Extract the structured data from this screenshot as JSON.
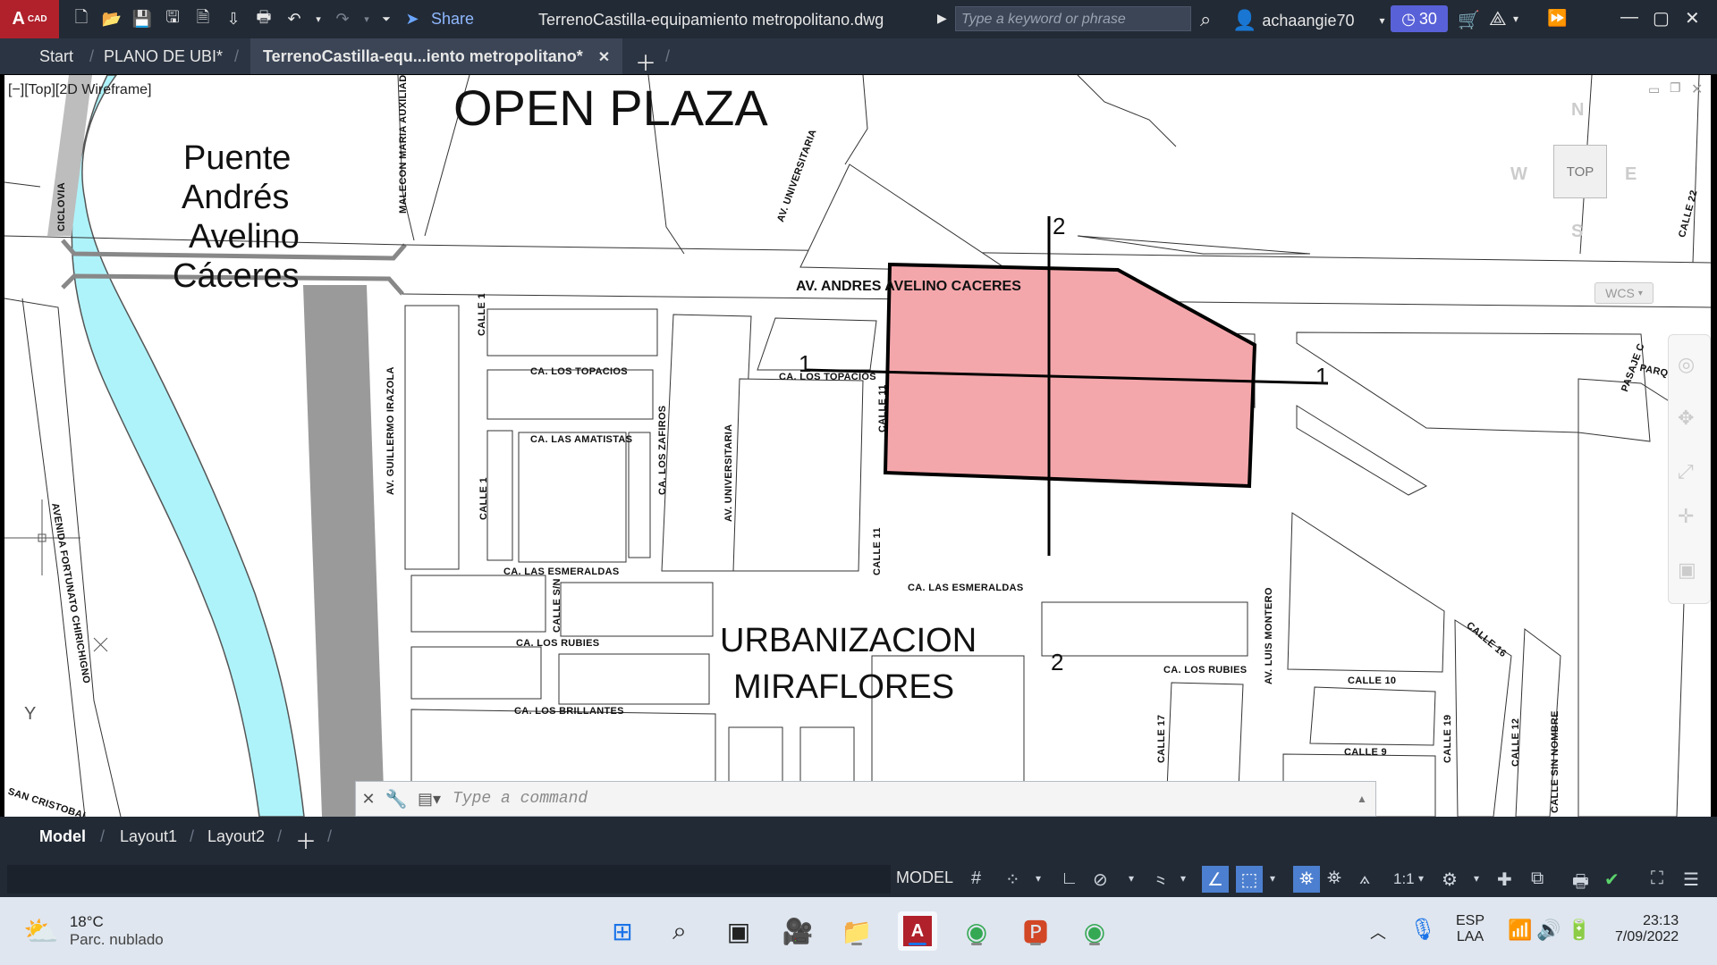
{
  "titlebar": {
    "app_badge": "A",
    "app_badge_sub": "CAD",
    "share_label": "Share",
    "document_title": "TerrenoCastilla-equipamiento metropolitano.dwg",
    "search_placeholder": "Type a keyword or phrase",
    "username": "achaangie70",
    "timer_value": "30"
  },
  "tabs": {
    "items": [
      {
        "label": "Start"
      },
      {
        "label": "PLANO DE UBI*"
      },
      {
        "label": "TerrenoCastilla-equ...iento metropolitano*"
      }
    ]
  },
  "viewport": {
    "label": "[−][Top][2D Wireframe]",
    "map": {
      "open_plaza": "OPEN PLAZA",
      "bridge_line1": "Puente",
      "bridge_line2": "Andrés",
      "bridge_line3": "Avelino",
      "bridge_line4": "Cáceres",
      "urbanizacion_line1": "URBANIZACION",
      "urbanizacion_line2": "MIRAFLORES",
      "av_andres": "AV.   ANDRES AVELINO CACERES",
      "section_2_top": "2",
      "section_2_bottom": "2",
      "section_1_left": "1",
      "section_1_right": "1",
      "streets": {
        "malecon": "MALECON MARIA AUXILIADORA",
        "ciclovia": "CICLOVIA",
        "av_universitaria_top": "AV. UNIVERSITARIA",
        "calle22": "CALLE 22",
        "los_topacios_1": "CA. LOS TOPACIOS",
        "los_topacios_2": "CA. LOS TOPACIOS",
        "las_amatistas": "CA. LAS AMATISTAS",
        "las_esmeraldas_1": "CA. LAS ESMERALDAS",
        "las_esmeraldas_2": "CA. LAS ESMERALDAS",
        "los_rubies_1": "CA. LOS RUBIES",
        "los_rubies_2": "CA. LOS RUBIES",
        "los_brillantes": "CA. LOS BRILLANTES",
        "calle1_a": "CALLE 1",
        "calle1_b": "CALLE 1",
        "calle11_a": "CALLE 11",
        "calle11_b": "CALLE 11",
        "calle_sn": "CALLE S/N",
        "los_zafiros": "CA. LOS ZAFIROS",
        "av_universitaria": "AV. UNIVERSITARIA",
        "av_guillermo": "AV. GUILLERMO IRAZOLA",
        "avenida_fortunato": "AVENIDA  FORTUNATO  CHIRICHIGNO",
        "av_luis_montero": "AV. LUIS MONTERO",
        "calle10": "CALLE 10",
        "calle9": "CALLE 9",
        "calle16": "CALLE 16",
        "calle17": "CALLE 17",
        "calle19": "CALLE 19",
        "calle12": "CALLE 12",
        "calle_sin_nombre": "CALLE SIN NOMBRE",
        "pasaje_c": "PASAJE C",
        "parque": "PARQUE",
        "san_cristobal": "SAN CRISTOBAL"
      }
    },
    "navcube": {
      "top": "TOP",
      "north": "N",
      "south": "S",
      "east": "E",
      "west": "W",
      "wcs": "WCS"
    },
    "ucs_y": "Y",
    "command_placeholder": "Type  a  command"
  },
  "layout_tabs": {
    "items": [
      {
        "label": "Model"
      },
      {
        "label": "Layout1"
      },
      {
        "label": "Layout2"
      }
    ]
  },
  "statusbar": {
    "model_label": "MODEL",
    "scale": "1:1"
  },
  "taskbar": {
    "weather_temp": "18°C",
    "weather_desc": "Parc. nublado",
    "lang_top": "ESP",
    "lang_bottom": "LAA",
    "time": "23:13",
    "date": "7/09/2022"
  },
  "colors": {
    "accent_red": "#b0212b",
    "parcel_fill": "#f4a7ab",
    "river": "#aef3fa",
    "timer_badge": "#5961d8"
  }
}
